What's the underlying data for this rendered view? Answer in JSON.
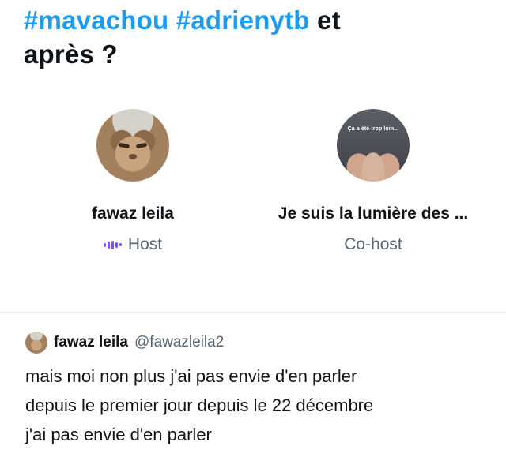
{
  "space": {
    "title_tags": [
      "#mavachou",
      "#adrienytb"
    ],
    "title_rest_line1": "et",
    "title_line2": "après ?"
  },
  "participants": [
    {
      "name": "fawaz leila",
      "role": "Host",
      "avatar_icon": "cat-avatar",
      "role_icon": "audio-bars-icon",
      "role_icon_color": "#7856ff"
    },
    {
      "name": "Je suis la lumière des ...",
      "role": "Co-host",
      "avatar_icon": "hands-photo-avatar",
      "avatar_caption": "Ça a été trop loin..."
    }
  ],
  "tweet": {
    "author_name": "fawaz leila",
    "author_handle": "@fawazleila2",
    "lines": [
      "mais moi non plus j'ai pas envie d'en parler",
      "depuis le premier jour depuis le 22 décembre",
      "j'ai pas envie d'en parler"
    ]
  },
  "colors": {
    "accent": "#1d9bf0",
    "text": "#0f1419",
    "muted": "#536471"
  }
}
